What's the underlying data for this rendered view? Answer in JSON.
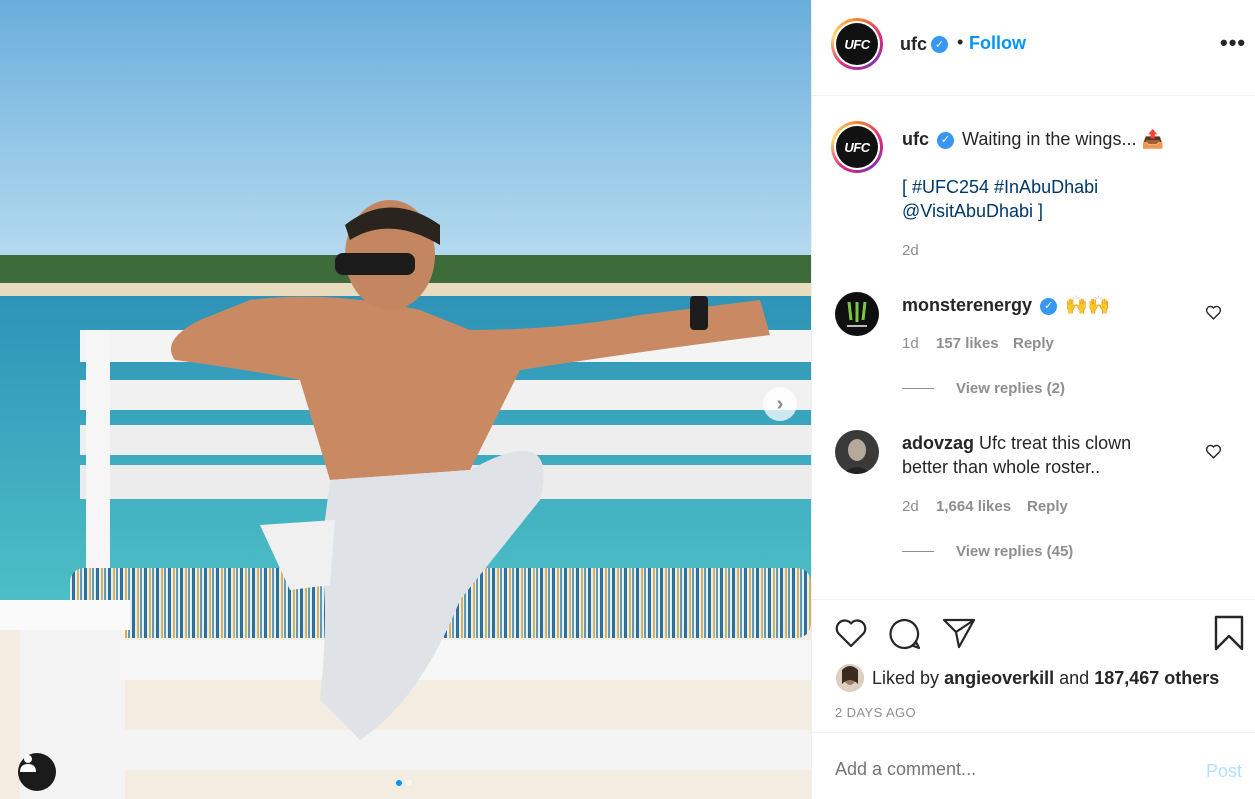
{
  "post": {
    "username": "ufc",
    "avatar_text": "UFC",
    "follow_label": "Follow",
    "separator": "•",
    "more_label": "•••"
  },
  "caption": {
    "username": "ufc",
    "text": "Waiting in the wings... 📤",
    "hashtags": "[ #UFC254 #InAbuDhabi",
    "mention": "@VisitAbuDhabi ]",
    "age": "2d"
  },
  "comments": [
    {
      "username": "monsterenergy",
      "verified": true,
      "text": "🙌🙌",
      "age": "1d",
      "likes": "157 likes",
      "reply": "Reply",
      "view_replies": "View replies (2)"
    },
    {
      "username": "adovzag",
      "verified": false,
      "text_line1": "Ufc treat this clown",
      "text_line2": "better than whole roster..",
      "age": "2d",
      "likes": "1,664 likes",
      "reply": "Reply",
      "view_replies": "View replies (45)"
    }
  ],
  "likes": {
    "prefix": "Liked by",
    "user": "angieoverkill",
    "mid": "and",
    "count": "187,467 others"
  },
  "timestamp": "2 DAYS AGO",
  "add_comment": {
    "placeholder": "Add a comment...",
    "post_label": "Post"
  },
  "carousel": {
    "current": 1,
    "total": 2
  },
  "colors": {
    "follow_blue": "#0095f6",
    "verified_blue": "#3897f0",
    "post_disabled": "#b2dffc",
    "link": "#00376b"
  },
  "icons": [
    "verified-badge-icon",
    "more-options-icon",
    "heart-icon",
    "comment-icon",
    "share-icon",
    "bookmark-icon",
    "chevron-right-icon",
    "user-tag-icon"
  ]
}
